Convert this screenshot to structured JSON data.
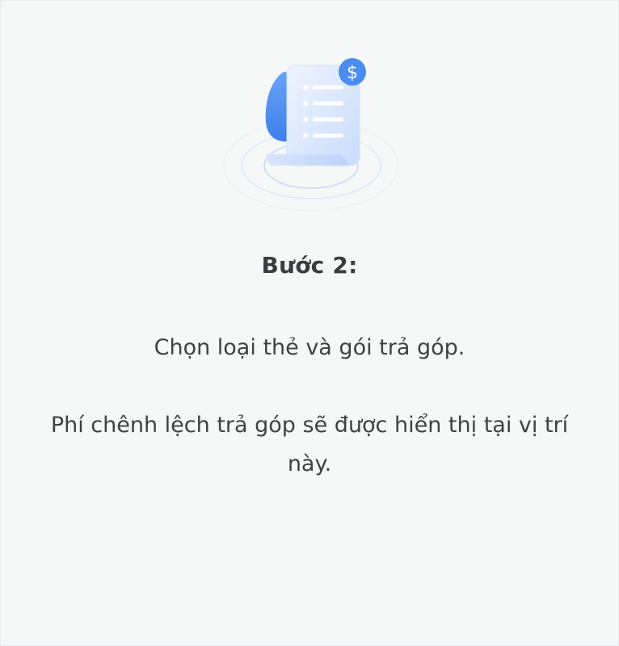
{
  "step": {
    "title": "Bước 2:"
  },
  "instructions": {
    "line1": "Chọn loại thẻ và gói trả góp.",
    "line2": "Phí chênh lệch trả góp sẽ được hiển thị tại vị trí này."
  },
  "illustration": {
    "icon": "invoice-dollar-icon",
    "badge_symbol": "$",
    "accent_color": "#4a8cf0",
    "light_color": "#dbe8fd"
  }
}
